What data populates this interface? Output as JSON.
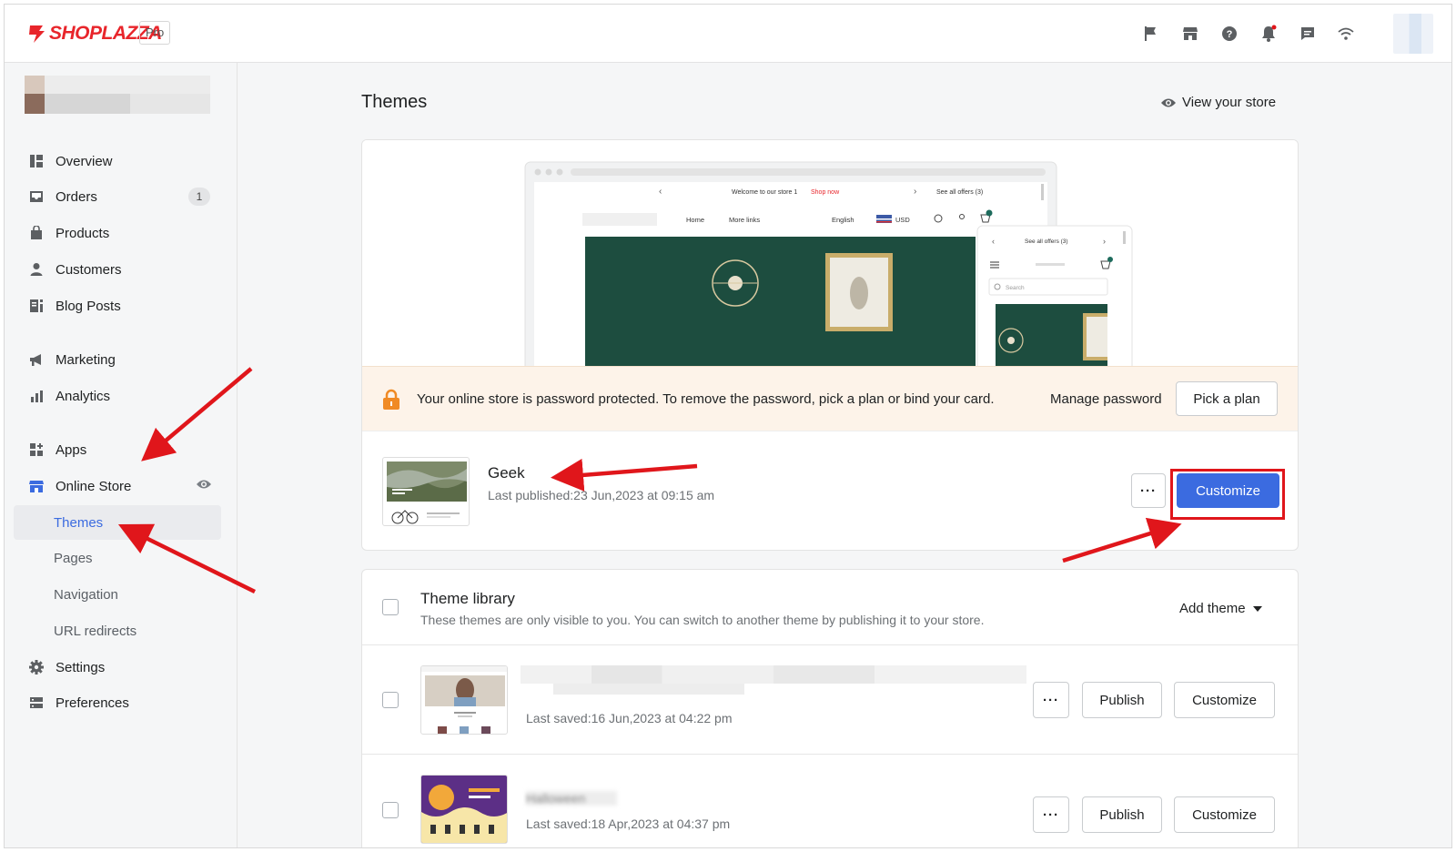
{
  "brand": {
    "name": "SHOPLAZZA",
    "plan_badge": "Pro",
    "logo_color": "#e8252b"
  },
  "topbar_icons": [
    "flag-icon",
    "storefront-icon",
    "help-icon",
    "bell-icon",
    "chat-icon",
    "wifi-icon"
  ],
  "sidebar": {
    "items": [
      {
        "label": "Overview",
        "icon": "overview-icon"
      },
      {
        "label": "Orders",
        "icon": "inbox-icon",
        "badge": "1"
      },
      {
        "label": "Products",
        "icon": "bag-icon"
      },
      {
        "label": "Customers",
        "icon": "person-icon"
      },
      {
        "label": "Blog Posts",
        "icon": "blog-icon"
      },
      {
        "label": "Marketing",
        "icon": "megaphone-icon"
      },
      {
        "label": "Analytics",
        "icon": "bar-chart-icon"
      },
      {
        "label": "Apps",
        "icon": "apps-icon"
      },
      {
        "label": "Online Store",
        "icon": "storefront-icon"
      },
      {
        "label": "Settings",
        "icon": "gear-icon"
      },
      {
        "label": "Preferences",
        "icon": "preferences-icon"
      }
    ],
    "sub_items": [
      "Themes",
      "Pages",
      "Navigation",
      "URL redirects"
    ],
    "active_sub": "Themes"
  },
  "page": {
    "title": "Themes",
    "view_store": "View your store"
  },
  "preview": {
    "desktop_top_text": "Welcome to our store 1",
    "desktop_shop_now": "Shop now",
    "desktop_offers": "See all offers (3)",
    "desktop_nav_home": "Home",
    "desktop_nav_more": "More links",
    "desktop_lang": "English",
    "desktop_currency": "USD",
    "mobile_offers": "See all offers (3)",
    "mobile_search": "Search",
    "accent": "#1d4d3f"
  },
  "password_banner": {
    "message": "Your online store is password protected. To remove the password, pick a plan or bind your card.",
    "manage_label": "Manage password",
    "plan_button": "Pick a plan"
  },
  "current_theme": {
    "name": "Geek",
    "published": "Last published:23 Jun,2023 at 09:15 am",
    "more_label": "···",
    "customize_label": "Customize"
  },
  "library": {
    "title": "Theme library",
    "description": "These themes are only visible to you. You can switch to another theme by publishing it to your store.",
    "add_theme_label": "Add theme",
    "rows": [
      {
        "name": "",
        "saved": "Last saved:16 Jun,2023 at 04:22 pm",
        "publish_label": "Publish",
        "customize_label": "Customize",
        "more_label": "···"
      },
      {
        "name": "Halloween",
        "saved": "Last saved:18 Apr,2023 at 04:37 pm",
        "publish_label": "Publish",
        "customize_label": "Customize",
        "more_label": "···"
      }
    ]
  },
  "colors": {
    "primary": "#3b6be0",
    "annotation": "#e0161b",
    "banner_bg": "#fdf3e9",
    "lock": "#f08a24"
  }
}
